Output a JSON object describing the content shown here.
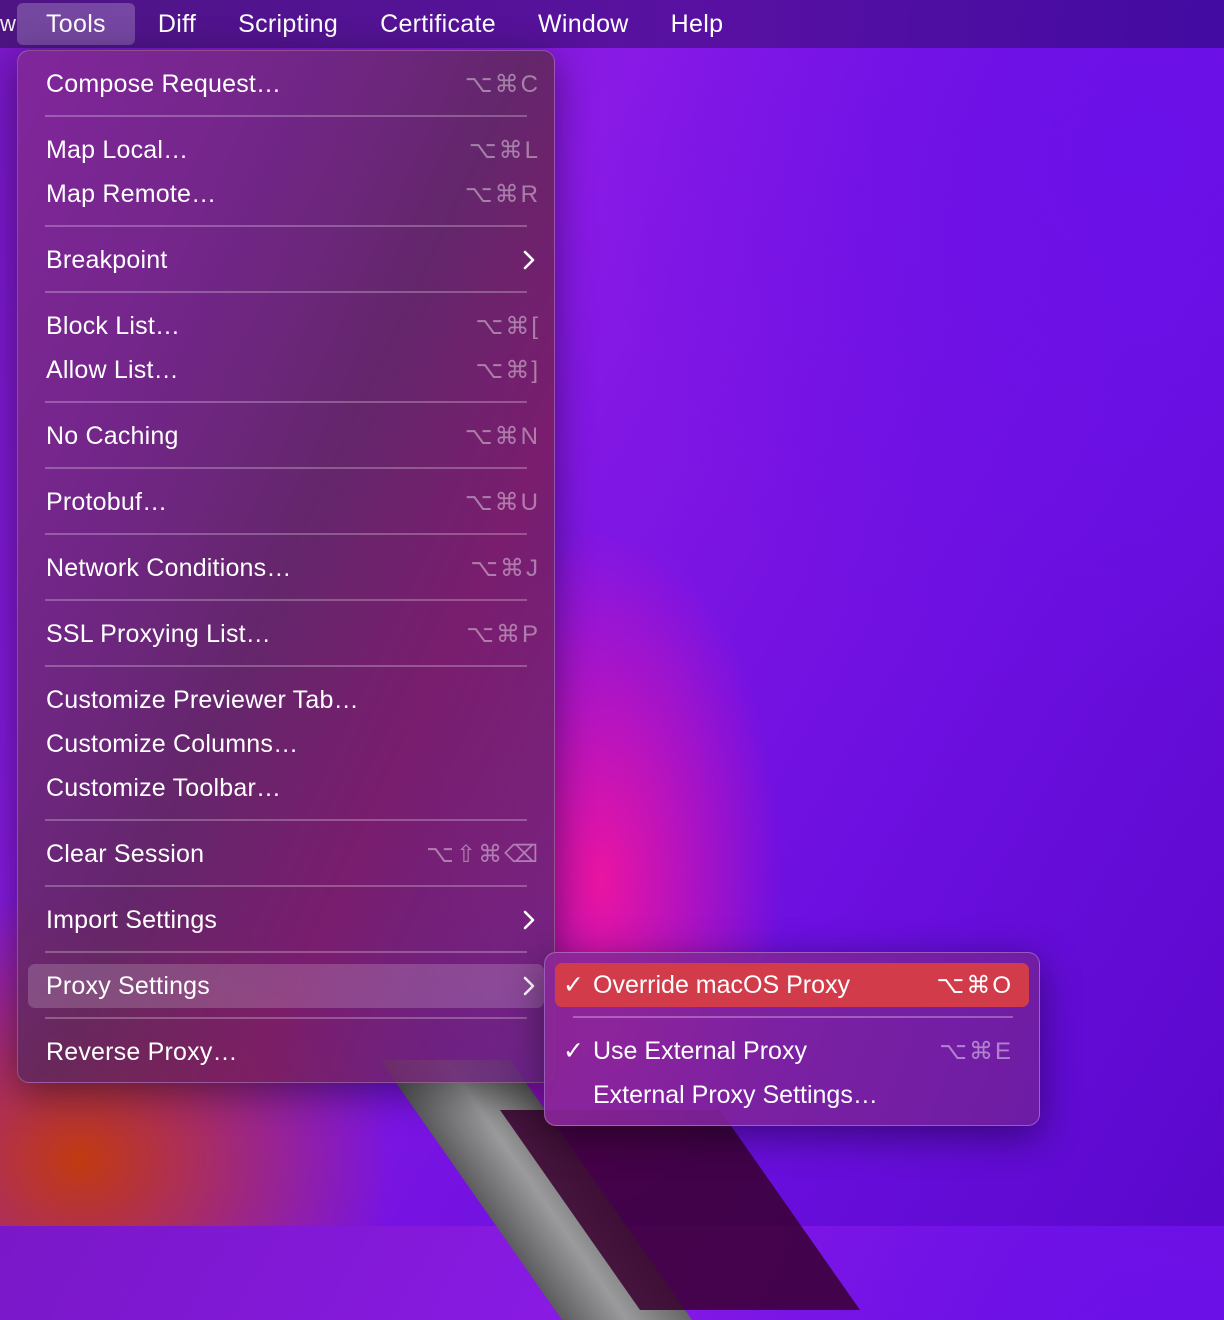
{
  "menubar": {
    "edge": "w",
    "items": [
      "Tools",
      "Diff",
      "Scripting",
      "Certificate",
      "Window",
      "Help"
    ]
  },
  "tools_menu": {
    "items": [
      {
        "label": "Compose Request…",
        "shortcut": "⌥⌘C"
      },
      {
        "label": "Map Local…",
        "shortcut": "⌥⌘L"
      },
      {
        "label": "Map Remote…",
        "shortcut": "⌥⌘R"
      },
      {
        "label": "Breakpoint",
        "submenu": true
      },
      {
        "label": "Block List…",
        "shortcut": "⌥⌘["
      },
      {
        "label": "Allow List…",
        "shortcut": "⌥⌘]"
      },
      {
        "label": "No Caching",
        "shortcut": "⌥⌘N"
      },
      {
        "label": "Protobuf…",
        "shortcut": "⌥⌘U"
      },
      {
        "label": "Network Conditions…",
        "shortcut": "⌥⌘J"
      },
      {
        "label": "SSL Proxying List…",
        "shortcut": "⌥⌘P"
      },
      {
        "label": "Customize Previewer Tab…"
      },
      {
        "label": "Customize Columns…"
      },
      {
        "label": "Customize Toolbar…"
      },
      {
        "label": "Clear Session",
        "shortcut": "⌥⇧⌘⌫"
      },
      {
        "label": "Import Settings",
        "submenu": true
      },
      {
        "label": "Proxy Settings",
        "submenu": true,
        "highlighted": true
      },
      {
        "label": "Reverse Proxy…"
      }
    ]
  },
  "proxy_submenu": {
    "items": [
      {
        "label": "Override macOS Proxy",
        "shortcut": "⌥⌘O",
        "checked": true,
        "selected": true
      },
      {
        "label": "Use External Proxy",
        "shortcut": "⌥⌘E",
        "checked": true
      },
      {
        "label": "External Proxy Settings…"
      }
    ],
    "check_glyph": "✓"
  },
  "colors": {
    "submenu_selection": "#d23c4a",
    "menubar_active": "rgba(255,255,255,0.22)"
  }
}
